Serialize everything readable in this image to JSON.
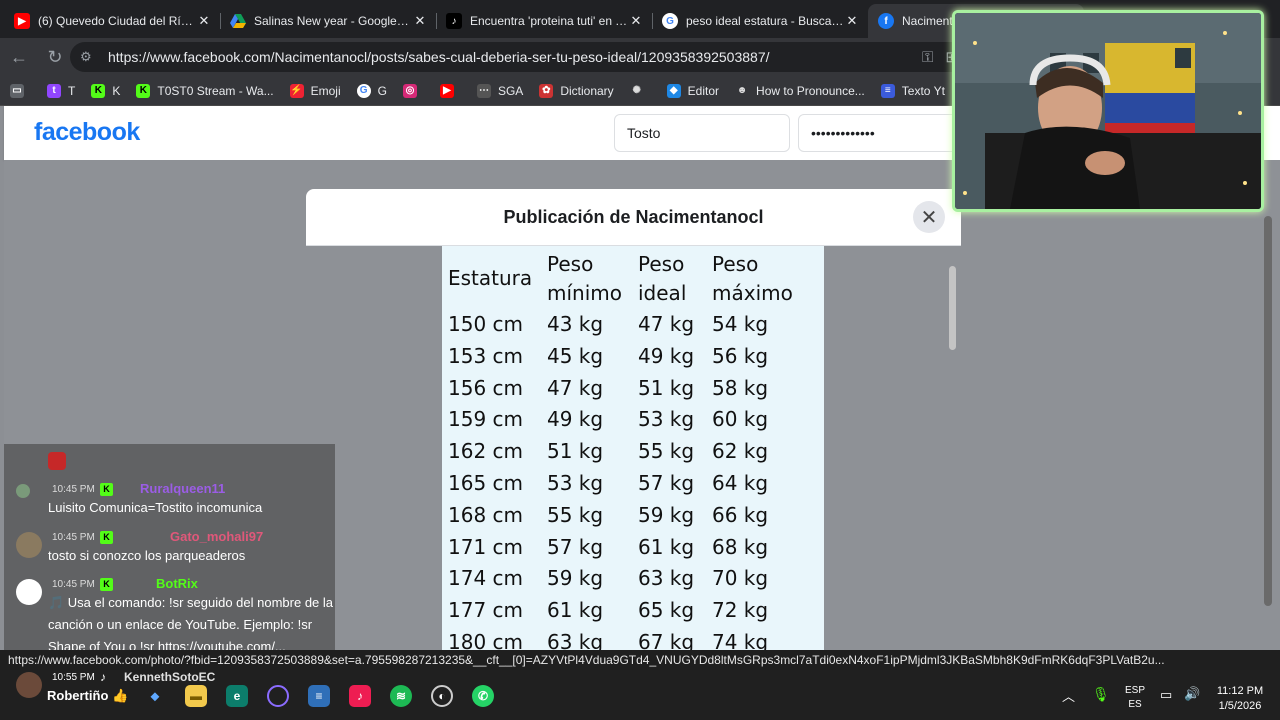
{
  "browser": {
    "tabs": [
      {
        "title": "(6) Quevedo Ciudad del Río - Re",
        "icon": "youtube-icon",
        "active": false
      },
      {
        "title": "Salinas New year - Google Drive",
        "icon": "google-drive-icon",
        "active": false
      },
      {
        "title": "Encuentra 'proteina tuti' en TikTo",
        "icon": "tiktok-icon",
        "active": false
      },
      {
        "title": "peso ideal estatura - Buscar con",
        "icon": "google-icon",
        "active": false
      },
      {
        "title": "Nacimentan",
        "icon": "facebook-icon",
        "active": true
      }
    ],
    "url": "https://www.facebook.com/Nacimentanocl/posts/sabes-cual-deberia-ser-tu-peso-ideal/1209358392503887/",
    "bookmarks": [
      "T",
      "K",
      "T0ST0 Stream - Wa...",
      "Emoji",
      "G",
      "",
      "",
      "SGA",
      "Dictionary",
      "",
      "Editor",
      "How to Pronounce...",
      "Texto Yt"
    ]
  },
  "facebook": {
    "logo": "facebook",
    "login_email": "Tosto",
    "login_password": "•••••••••••••",
    "modal_title": "Publicación de Nacimentanocl",
    "close_label": "✕"
  },
  "table": {
    "headers": [
      [
        "Estatura"
      ],
      [
        "Peso",
        "mínimo"
      ],
      [
        "Peso",
        "ideal"
      ],
      [
        "Peso",
        "máximo"
      ]
    ],
    "rows": [
      [
        "150 cm",
        "43 kg",
        "47 kg",
        "54 kg"
      ],
      [
        "153 cm",
        "45 kg",
        "49 kg",
        "56 kg"
      ],
      [
        "156 cm",
        "47 kg",
        "51 kg",
        "58 kg"
      ],
      [
        "159 cm",
        "49 kg",
        "53 kg",
        "60 kg"
      ],
      [
        "162 cm",
        "51 kg",
        "55 kg",
        "62 kg"
      ],
      [
        "165 cm",
        "53 kg",
        "57 kg",
        "64 kg"
      ],
      [
        "168 cm",
        "55 kg",
        "59 kg",
        "66 kg"
      ],
      [
        "171 cm",
        "57 kg",
        "61 kg",
        "68 kg"
      ],
      [
        "174 cm",
        "59 kg",
        "63 kg",
        "70 kg"
      ],
      [
        "177 cm",
        "61 kg",
        "65 kg",
        "72 kg"
      ],
      [
        "180 cm",
        "63 kg",
        "67 kg",
        "74 kg"
      ]
    ]
  },
  "chat": {
    "messages": [
      {
        "time": "10:45 PM",
        "user": "Ruralqueen11",
        "user_color": "#9b5de5",
        "text": "Luisito Comunica=Tostito incomunica"
      },
      {
        "time": "10:45 PM",
        "user": "Gato_mohali97",
        "user_color": "#e0587a",
        "text": "tosto si conozco los parqueaderos"
      },
      {
        "time": "10:45 PM",
        "user": "BotRix",
        "user_color": "#53fc18",
        "text": "🎵 Usa el comando: !sr seguido del nombre de la canción o un enlace de YouTube. Ejemplo: !sr Shape of You o !sr https://youtube.com/..."
      },
      {
        "time": "10:55 PM",
        "user": "KennethSotoEC",
        "user_color": "#ffffff",
        "text": "Robertiño 👍"
      }
    ]
  },
  "status_url": "https://www.facebook.com/photo/?fbid=1209358372503889&set=a.795598287213235&__cft__[0]=AZYVtPl4Vdua9GTd4_VNUGYDd8ltMsGRps3mcl7aTdi0exN4xoF1ipPMjdml3JKBaSMbh8K9dFmRK6dqF3PLVatB2u...",
  "taskbar": {
    "lang_top": "ESP",
    "lang_bottom": "ES",
    "time": "11:12 PM",
    "date": "1/5/2026"
  },
  "colors": {
    "facebook_blue": "#1877f2",
    "kick_green": "#53fc18",
    "webcam_border": "#a8f0a0"
  }
}
